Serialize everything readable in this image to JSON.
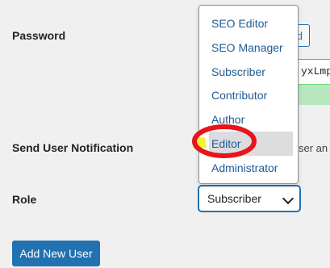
{
  "form": {
    "password_label": "Password",
    "password_button_partial": "d",
    "password_value_partial": "yxLmp",
    "send_notification_label": "Send User Notification",
    "notification_text_partial": "ser an",
    "role_label": "Role",
    "role_selected": "Subscriber",
    "add_button": "Add New User"
  },
  "dropdown": {
    "options": [
      "SEO Editor",
      "SEO Manager",
      "Subscriber",
      "Contributor",
      "Author",
      "Editor",
      "Administrator"
    ],
    "highlighted": "Editor"
  },
  "colors": {
    "primary": "#2271b1",
    "link": "#1d5b94",
    "annotation_red": "#e8141b",
    "annotation_highlight": "#f2f21a",
    "strength_bg": "#b8e6bf"
  }
}
